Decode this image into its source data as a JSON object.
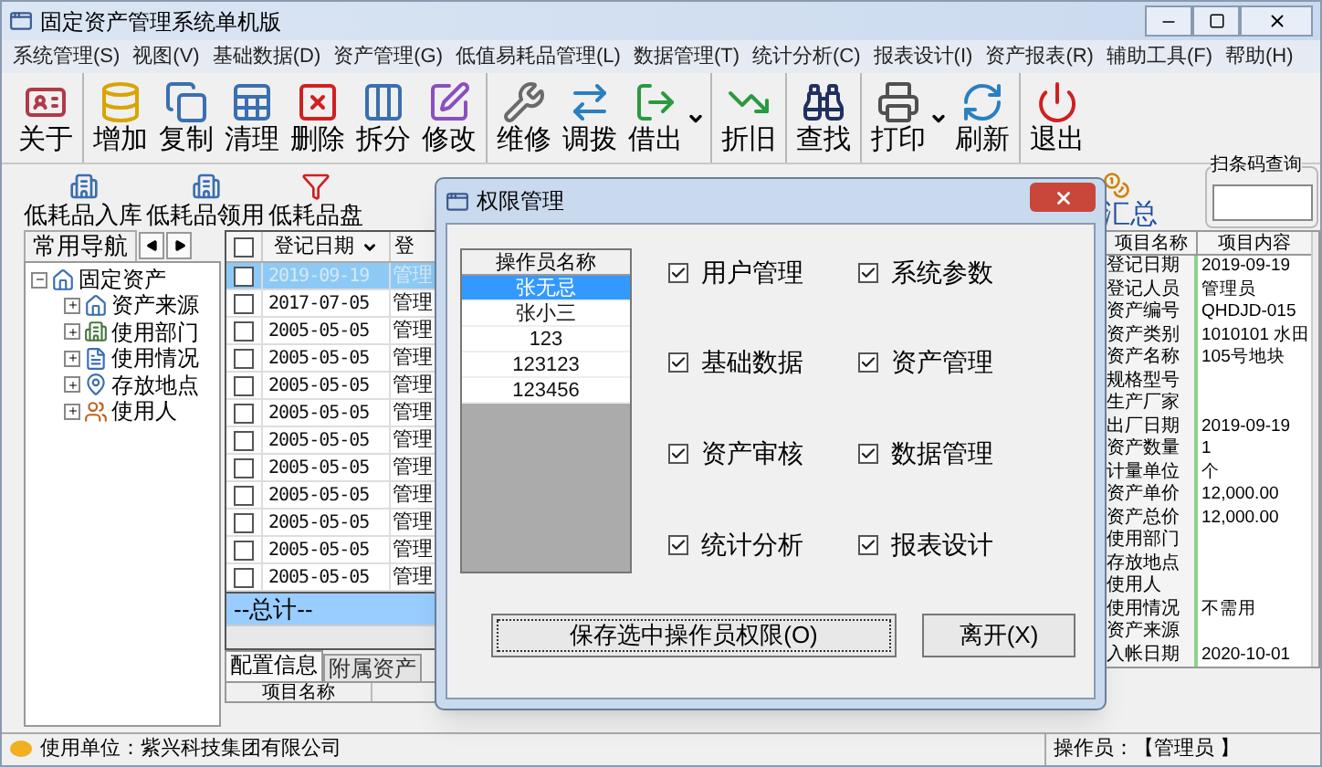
{
  "window": {
    "title": "固定资产管理系统单机版"
  },
  "menu": [
    "系统管理(S)",
    "视图(V)",
    "基础数据(D)",
    "资产管理(G)",
    "低值易耗品管理(L)",
    "数据管理(T)",
    "统计分析(C)",
    "报表设计(I)",
    "资产报表(R)",
    "辅助工具(F)",
    "帮助(H)"
  ],
  "toolbar": [
    {
      "items": [
        {
          "label": "关于",
          "dropdown": false
        }
      ]
    },
    {
      "items": [
        {
          "label": "增加",
          "dropdown": false
        },
        {
          "label": "复制",
          "dropdown": false
        },
        {
          "label": "清理",
          "dropdown": false
        },
        {
          "label": "删除",
          "dropdown": false
        },
        {
          "label": "拆分",
          "dropdown": false
        },
        {
          "label": "修改",
          "dropdown": false
        }
      ]
    },
    {
      "items": [
        {
          "label": "维修",
          "dropdown": false
        },
        {
          "label": "调拨",
          "dropdown": false
        },
        {
          "label": "借出",
          "dropdown": true
        }
      ]
    },
    {
      "items": [
        {
          "label": "折旧",
          "dropdown": false
        }
      ]
    },
    {
      "items": [
        {
          "label": "查找",
          "dropdown": false
        }
      ]
    },
    {
      "items": [
        {
          "label": "打印",
          "dropdown": true
        },
        {
          "label": "刷新",
          "dropdown": false
        }
      ]
    },
    {
      "items": [
        {
          "label": "退出",
          "dropdown": false
        }
      ]
    }
  ],
  "quick_bar": {
    "items": [
      "低耗品入库",
      "低耗品领用",
      "低耗品盘"
    ],
    "summary": "汇总"
  },
  "barcode": {
    "label": "扫条码查询"
  },
  "nav": {
    "tab": "常用导航",
    "tree": [
      {
        "label": "固定资产",
        "expanded": true,
        "children": [
          {
            "label": "资产来源",
            "expanded": false
          },
          {
            "label": "使用部门",
            "expanded": false
          },
          {
            "label": "使用情况",
            "expanded": false
          },
          {
            "label": "存放地点",
            "expanded": false
          },
          {
            "label": "使用人",
            "expanded": false
          }
        ]
      }
    ]
  },
  "grid": {
    "columns": [
      "登记日期",
      "登"
    ],
    "select_all": {
      "checked": false
    },
    "rows": [
      {
        "date": "2019-09-19",
        "column_2": "管理",
        "selected": true,
        "checked": false
      },
      {
        "date": "2017-07-05",
        "column_2": "管理",
        "selected": false,
        "checked": false
      },
      {
        "date": "2005-05-05",
        "column_2": "管理",
        "selected": false,
        "checked": false
      },
      {
        "date": "2005-05-05",
        "column_2": "管理",
        "selected": false,
        "checked": false
      },
      {
        "date": "2005-05-05",
        "column_2": "管理",
        "selected": false,
        "checked": false
      },
      {
        "date": "2005-05-05",
        "column_2": "管理",
        "selected": false,
        "checked": false
      },
      {
        "date": "2005-05-05",
        "column_2": "管理",
        "selected": false,
        "checked": false
      },
      {
        "date": "2005-05-05",
        "column_2": "管理",
        "selected": false,
        "checked": false
      },
      {
        "date": "2005-05-05",
        "column_2": "管理",
        "selected": false,
        "checked": false
      },
      {
        "date": "2005-05-05",
        "column_2": "管理",
        "selected": false,
        "checked": false
      },
      {
        "date": "2005-05-05",
        "column_2": "管理",
        "selected": false,
        "checked": false
      },
      {
        "date": "2005-05-05",
        "column_2": "管理",
        "selected": false,
        "checked": false
      }
    ],
    "total": "--总计--",
    "tabs": [
      {
        "label": "配置信息",
        "selected": true
      },
      {
        "label": "附属资产",
        "selected": false
      }
    ],
    "sub_column": "项目名称"
  },
  "details": {
    "columns": [
      "项目名称",
      "项目内容"
    ],
    "rows": [
      {
        "name": "登记日期",
        "value": "2019-09-19"
      },
      {
        "name": "登记人员",
        "value": "管理员"
      },
      {
        "name": "资产编号",
        "value": "QHDJD-015"
      },
      {
        "name": "资产类别",
        "value": "1010101 水田"
      },
      {
        "name": "资产名称",
        "value": "105号地块"
      },
      {
        "name": "规格型号"
      },
      {
        "name": "生产厂家"
      },
      {
        "name": "出厂日期",
        "value": "2019-09-19"
      },
      {
        "name": "资产数量",
        "value": "1"
      },
      {
        "name": "计量单位",
        "value": "个"
      },
      {
        "name": "资产单价",
        "value": "12,000.00"
      },
      {
        "name": "资产总价",
        "value": "12,000.00"
      },
      {
        "name": "使用部门"
      },
      {
        "name": "存放地点"
      },
      {
        "name": "使用人"
      },
      {
        "name": "使用情况",
        "value": "不需用"
      },
      {
        "name": "资产来源"
      },
      {
        "name": "入帐日期",
        "value": "2020-10-01"
      }
    ]
  },
  "dialog": {
    "title": "权限管理",
    "list_header": "操作员名称",
    "operators": [
      {
        "name": "张无忌",
        "selected": true
      },
      {
        "name": "张小三",
        "selected": false
      },
      {
        "name": "123",
        "selected": false
      },
      {
        "name": "123123",
        "selected": false
      },
      {
        "name": "123456",
        "selected": false
      }
    ],
    "permissions": [
      {
        "label": "用户管理",
        "checked": true
      },
      {
        "label": "系统参数",
        "checked": true
      },
      {
        "label": "基础数据",
        "checked": true
      },
      {
        "label": "资产管理",
        "checked": true
      },
      {
        "label": "资产审核",
        "checked": true
      },
      {
        "label": "数据管理",
        "checked": true
      },
      {
        "label": "统计分析",
        "checked": true
      },
      {
        "label": "报表设计",
        "checked": true
      }
    ],
    "buttons": [
      "保存选中操作员权限(O)",
      "离开(X)"
    ]
  },
  "status_bar": {
    "unit": "使用单位：紫兴科技集团有限公司",
    "operator": "操作员：【管理员 】"
  }
}
